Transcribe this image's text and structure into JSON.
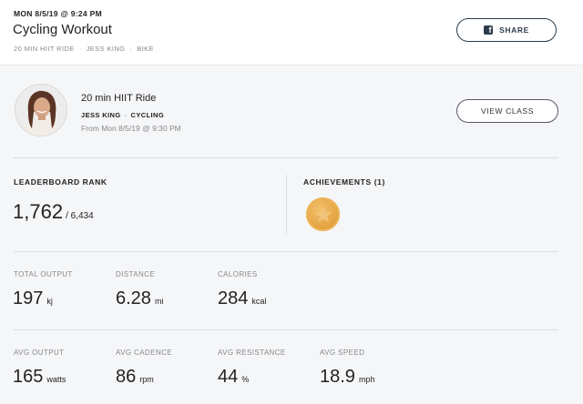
{
  "header": {
    "datetime": "MON 8/5/19 @ 9:24 PM",
    "title": "Cycling Workout",
    "subtitle": [
      "20 MIN HIIT RIDE",
      "JESS KING",
      "BIKE"
    ],
    "share_label": "SHARE"
  },
  "class_info": {
    "name": "20 min HIIT Ride",
    "instructor": "JESS KING",
    "type": "CYCLING",
    "date": "From Mon 8/5/19 @ 9:30 PM",
    "view_label": "VIEW CLASS"
  },
  "leaderboard": {
    "label": "LEADERBOARD RANK",
    "rank": "1,762",
    "total": "/ 6,434"
  },
  "achievements": {
    "label": "ACHIEVEMENTS (1)",
    "badge_icon": "star-medal-icon",
    "badge_color": "#e4a544"
  },
  "stats_row1": [
    {
      "label": "TOTAL OUTPUT",
      "value": "197",
      "unit": "kj"
    },
    {
      "label": "DISTANCE",
      "value": "6.28",
      "unit": "mi"
    },
    {
      "label": "CALORIES",
      "value": "284",
      "unit": "kcal"
    }
  ],
  "stats_row2": [
    {
      "label": "AVG OUTPUT",
      "value": "165",
      "unit": "watts"
    },
    {
      "label": "AVG CADENCE",
      "value": "86",
      "unit": "rpm"
    },
    {
      "label": "AVG RESISTANCE",
      "value": "44",
      "unit": "%"
    },
    {
      "label": "AVG SPEED",
      "value": "18.9",
      "unit": "mph"
    }
  ]
}
